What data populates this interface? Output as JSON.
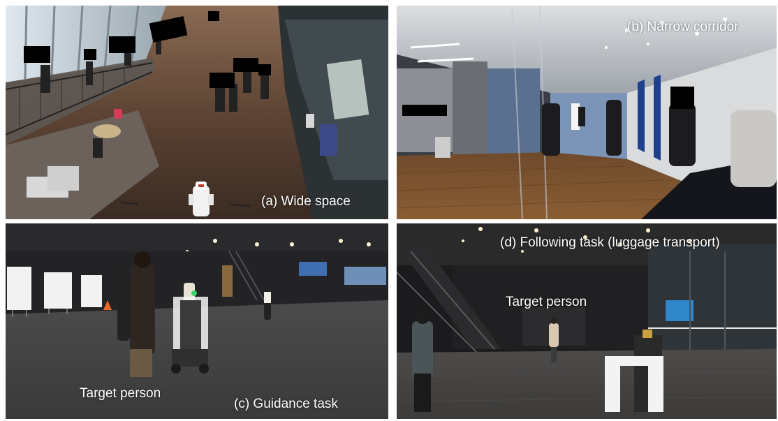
{
  "panels": {
    "a": {
      "caption": "(a) Wide space"
    },
    "b": {
      "caption": "(b) Narrow corridor"
    },
    "c": {
      "caption": "(c) Guidance task",
      "target_label": "Target person"
    },
    "d": {
      "caption": "(d) Following task (luggage transport)",
      "target_label": "Target person"
    }
  }
}
